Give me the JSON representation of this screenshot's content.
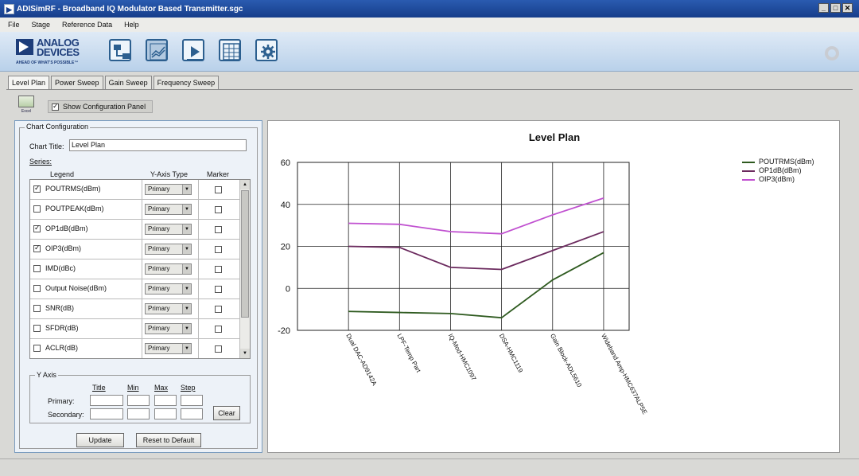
{
  "window": {
    "title": "ADISimRF - Broadband IQ Modulator Based Transmitter.sgc",
    "app_icon": "▶",
    "minimize": "_",
    "maximize": "□",
    "close": "✕"
  },
  "menu": [
    "File",
    "Stage",
    "Reference Data",
    "Help"
  ],
  "logo": {
    "line1": "ANALOG",
    "line2": "DEVICES",
    "tagline": "AHEAD OF WHAT'S POSSIBLE™"
  },
  "toolbar_icons": [
    "stage-flow-icon",
    "chart-icon",
    "play-icon",
    "table-icon",
    "gear-icon"
  ],
  "tabs": [
    "Level Plan",
    "Power Sweep",
    "Gain Sweep",
    "Frequency Sweep"
  ],
  "excel_button": {
    "label": "Excel"
  },
  "show_config_panel": {
    "label": "Show Configuration Panel",
    "checked": true
  },
  "config": {
    "group_label": "Chart Configuration",
    "chart_title_label": "Chart Title:",
    "chart_title_value": "Level Plan",
    "series_label": "Series:",
    "col_legend": "Legend",
    "col_yaxis": "Y-Axis Type",
    "col_marker": "Marker",
    "series": [
      {
        "name": "POUTRMS(dBm)",
        "checked": true,
        "axis": "Primary",
        "marker": false
      },
      {
        "name": "POUTPEAK(dBm)",
        "checked": false,
        "axis": "Primary",
        "marker": false
      },
      {
        "name": "OP1dB(dBm)",
        "checked": true,
        "axis": "Primary",
        "marker": false
      },
      {
        "name": "OIP3(dBm)",
        "checked": true,
        "axis": "Primary",
        "marker": false
      },
      {
        "name": "IMD(dBc)",
        "checked": false,
        "axis": "Primary",
        "marker": false
      },
      {
        "name": "Output Noise(dBm)",
        "checked": false,
        "axis": "Primary",
        "marker": false
      },
      {
        "name": "SNR(dB)",
        "checked": false,
        "axis": "Primary",
        "marker": false
      },
      {
        "name": "SFDR(dB)",
        "checked": false,
        "axis": "Primary",
        "marker": false
      },
      {
        "name": "ACLR(dB)",
        "checked": false,
        "axis": "Primary",
        "marker": false
      }
    ],
    "y_axis": {
      "group_label": "Y Axis",
      "col_title": "Title",
      "col_min": "Min",
      "col_max": "Max",
      "col_step": "Step",
      "row_primary": "Primary:",
      "row_secondary": "Secondary:",
      "clear": "Clear"
    },
    "update": "Update",
    "reset": "Reset to Default"
  },
  "chart_data": {
    "type": "line",
    "title": "Level Plan",
    "categories": [
      "Dual DAC-AD9142A",
      "LPF-Temp Part",
      "IQ-Mod-HMC1097",
      "DSA-HMC1119",
      "Gain Block-ADL5610",
      "Wideband Amp-HMC637ALP5E"
    ],
    "ylim": [
      -20,
      60
    ],
    "yticks": [
      -20,
      0,
      20,
      40,
      60
    ],
    "grid": true,
    "legend_position": "right",
    "series": [
      {
        "name": "POUTRMS(dBm)",
        "color": "#2e5a1f",
        "values": [
          -11,
          -11.5,
          -12,
          -14,
          4,
          17
        ]
      },
      {
        "name": "OP1dB(dBm)",
        "color": "#6b2a5e",
        "values": [
          20,
          19.5,
          10,
          9,
          18,
          27
        ]
      },
      {
        "name": "OIP3(dBm)",
        "color": "#c050d0",
        "values": [
          31,
          30.5,
          27,
          26,
          35,
          43
        ]
      }
    ]
  }
}
